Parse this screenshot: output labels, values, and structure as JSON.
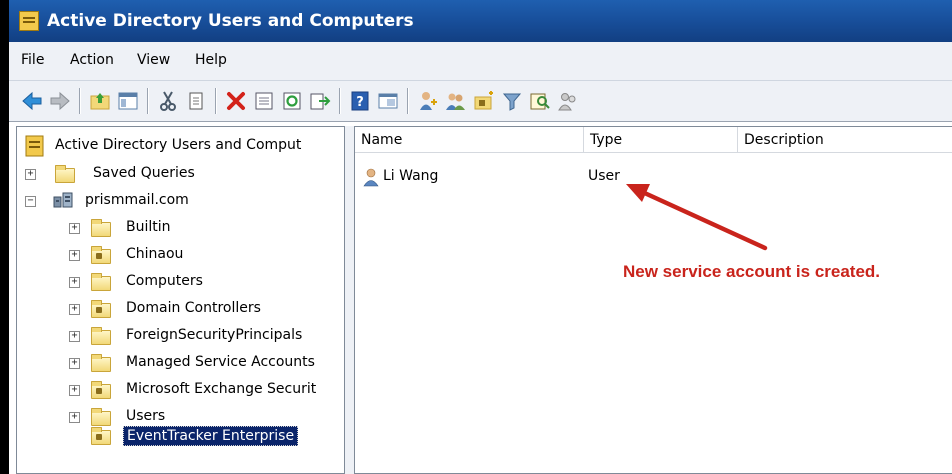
{
  "window": {
    "title": "Active Directory Users and Computers",
    "icon": "ad-console-icon"
  },
  "menu": {
    "items": [
      "File",
      "Action",
      "View",
      "Help"
    ]
  },
  "toolbar": {
    "icons": [
      "back-arrow-icon",
      "forward-arrow-icon",
      "up-folder-icon",
      "show-tree-icon",
      "cut-icon",
      "copy-icon",
      "delete-icon",
      "properties-icon",
      "refresh-icon",
      "export-list-icon",
      "help-icon",
      "console-view-icon",
      "users-icon",
      "groups-icon",
      "ou-icon",
      "filter-icon",
      "find-icon",
      "delegate-icon"
    ]
  },
  "tree": {
    "root": "Active Directory Users and Comput",
    "saved_queries": "Saved Queries",
    "domain": "prismmail.com",
    "children": [
      {
        "label": "Builtin",
        "kind": "folder"
      },
      {
        "label": "Chinaou",
        "kind": "ou"
      },
      {
        "label": "Computers",
        "kind": "folder"
      },
      {
        "label": "Domain Controllers",
        "kind": "ou"
      },
      {
        "label": "ForeignSecurityPrincipals",
        "kind": "folder"
      },
      {
        "label": "Managed Service Accounts",
        "kind": "folder"
      },
      {
        "label": "Microsoft Exchange Securit",
        "kind": "ou"
      },
      {
        "label": "Users",
        "kind": "folder"
      }
    ],
    "selected": "EventTracker Enterprise"
  },
  "list": {
    "columns": [
      "Name",
      "Type",
      "Description"
    ],
    "rows": [
      {
        "name": "Li Wang",
        "type": "User",
        "description": ""
      }
    ]
  },
  "annotation": {
    "text": "New service account is created.",
    "color": "#c9241c"
  }
}
